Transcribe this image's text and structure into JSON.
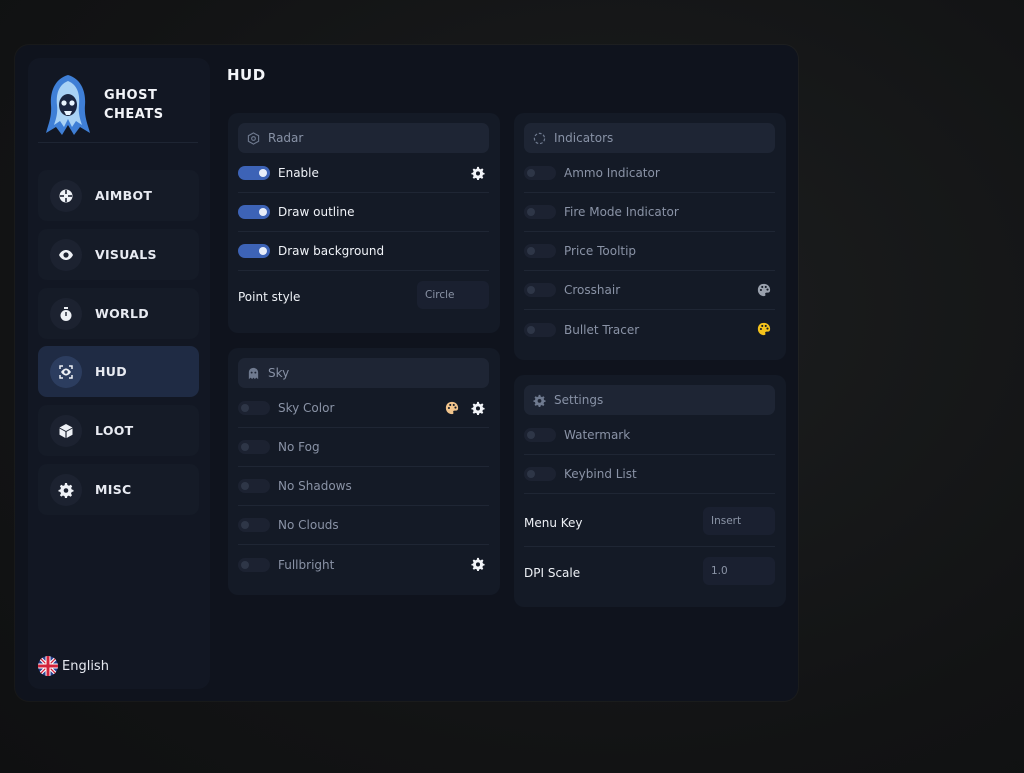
{
  "brand": {
    "line1": "GHOST",
    "line2": "CHEATS"
  },
  "nav": [
    {
      "label": "AIMBOT",
      "icon": "crosshair-icon",
      "active": false
    },
    {
      "label": "VISUALS",
      "icon": "eye-icon",
      "active": false
    },
    {
      "label": "WORLD",
      "icon": "stopwatch-icon",
      "active": false
    },
    {
      "label": "HUD",
      "icon": "hud-eye-icon",
      "active": true
    },
    {
      "label": "LOOT",
      "icon": "box-icon",
      "active": false
    },
    {
      "label": "MISC",
      "icon": "gear-icon",
      "active": false
    }
  ],
  "language": {
    "label": "English",
    "icon": "uk-flag-icon"
  },
  "page_title": "HUD",
  "radar": {
    "title": "Radar",
    "enable": {
      "label": "Enable",
      "on": true
    },
    "draw_outline": {
      "label": "Draw outline",
      "on": true
    },
    "draw_background": {
      "label": "Draw background",
      "on": true
    },
    "point_style": {
      "label": "Point style",
      "value": "Circle"
    }
  },
  "sky": {
    "title": "Sky",
    "sky_color": {
      "label": "Sky Color",
      "on": false
    },
    "no_fog": {
      "label": "No Fog",
      "on": false
    },
    "no_shadows": {
      "label": "No Shadows",
      "on": false
    },
    "no_clouds": {
      "label": "No Clouds",
      "on": false
    },
    "fullbright": {
      "label": "Fullbright",
      "on": false
    }
  },
  "indicators": {
    "title": "Indicators",
    "ammo": {
      "label": "Ammo Indicator",
      "on": false
    },
    "fire_mode": {
      "label": "Fire Mode Indicator",
      "on": false
    },
    "price_tooltip": {
      "label": "Price Tooltip",
      "on": false
    },
    "crosshair": {
      "label": "Crosshair",
      "on": false
    },
    "bullet_tracer": {
      "label": "Bullet Tracer",
      "on": false
    }
  },
  "settings": {
    "title": "Settings",
    "watermark": {
      "label": "Watermark",
      "on": false
    },
    "keybind_list": {
      "label": "Keybind List",
      "on": false
    },
    "menu_key": {
      "label": "Menu Key",
      "value": "Insert"
    },
    "dpi_scale": {
      "label": "DPI Scale",
      "value": "1.0"
    }
  },
  "colors": {
    "accent": "#3d63b6",
    "palette_peach": "#f1c48c",
    "palette_gray": "#9aa1ad",
    "palette_yellow": "#f4c21b"
  }
}
